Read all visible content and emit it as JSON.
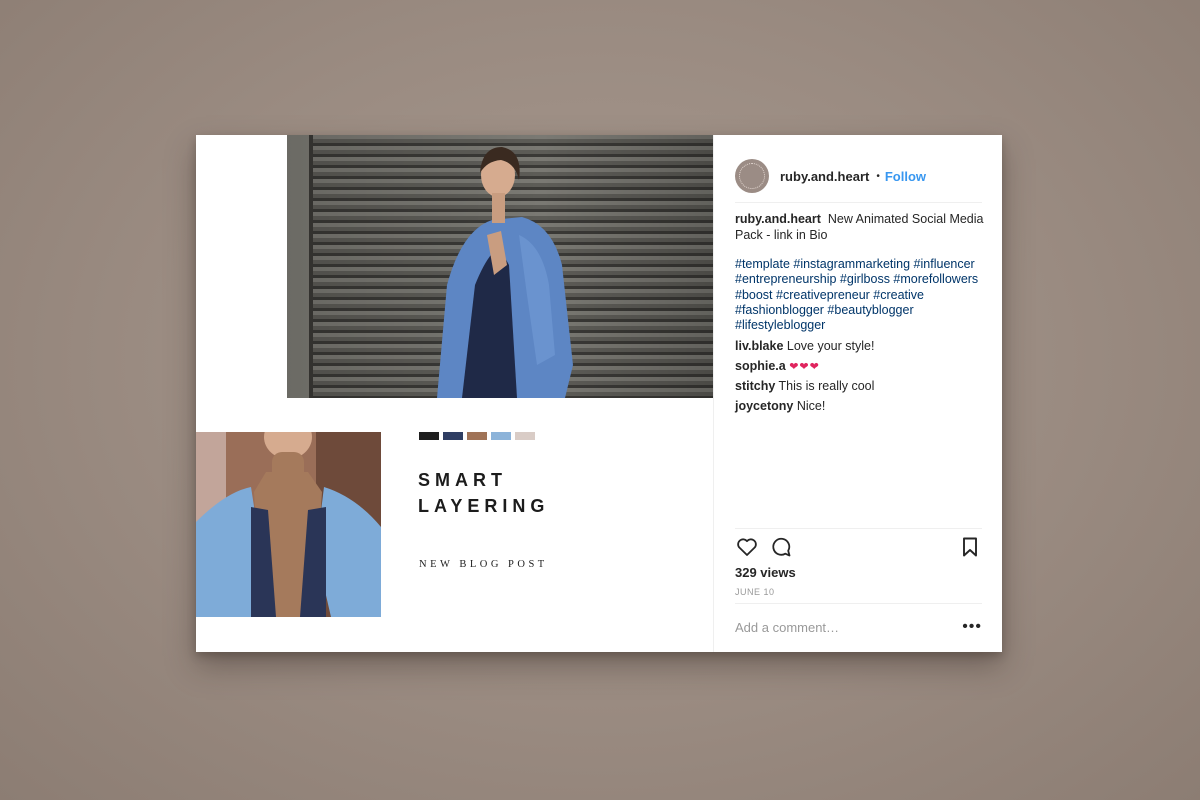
{
  "post": {
    "headline_line1": "SMART",
    "headline_line2": "LAYERING",
    "subline": "NEW BLOG POST",
    "palette": [
      "#1f1f1f",
      "#2f3e63",
      "#a07357",
      "#8cb3d9",
      "#d9ccc6"
    ]
  },
  "header": {
    "username": "ruby.and.heart",
    "separator": "•",
    "follow_label": "Follow"
  },
  "caption": {
    "username": "ruby.and.heart",
    "text": "New Animated Social Media Pack - link in Bio",
    "hashtags": "#template #instagrammarketing #influencer #entrepreneurship #girlboss #morefollowers #boost #creativepreneur #creative #fashionblogger #beautyblogger #lifestyleblogger"
  },
  "comments": [
    {
      "user": "liv.blake",
      "text": "Love your style!"
    },
    {
      "user": "sophie.a",
      "text": "❤❤❤"
    },
    {
      "user": "stitchy",
      "text": "This is really cool"
    },
    {
      "user": "joycetony",
      "text": "Nice!"
    }
  ],
  "stats": {
    "views": "329 views",
    "date": "JUNE 10"
  },
  "add_comment": {
    "placeholder": "Add a comment…",
    "more_label": "•••"
  },
  "icons": {
    "like": "heart-icon",
    "comment": "comment-bubble-icon",
    "save": "bookmark-icon",
    "more": "more-options-icon"
  }
}
